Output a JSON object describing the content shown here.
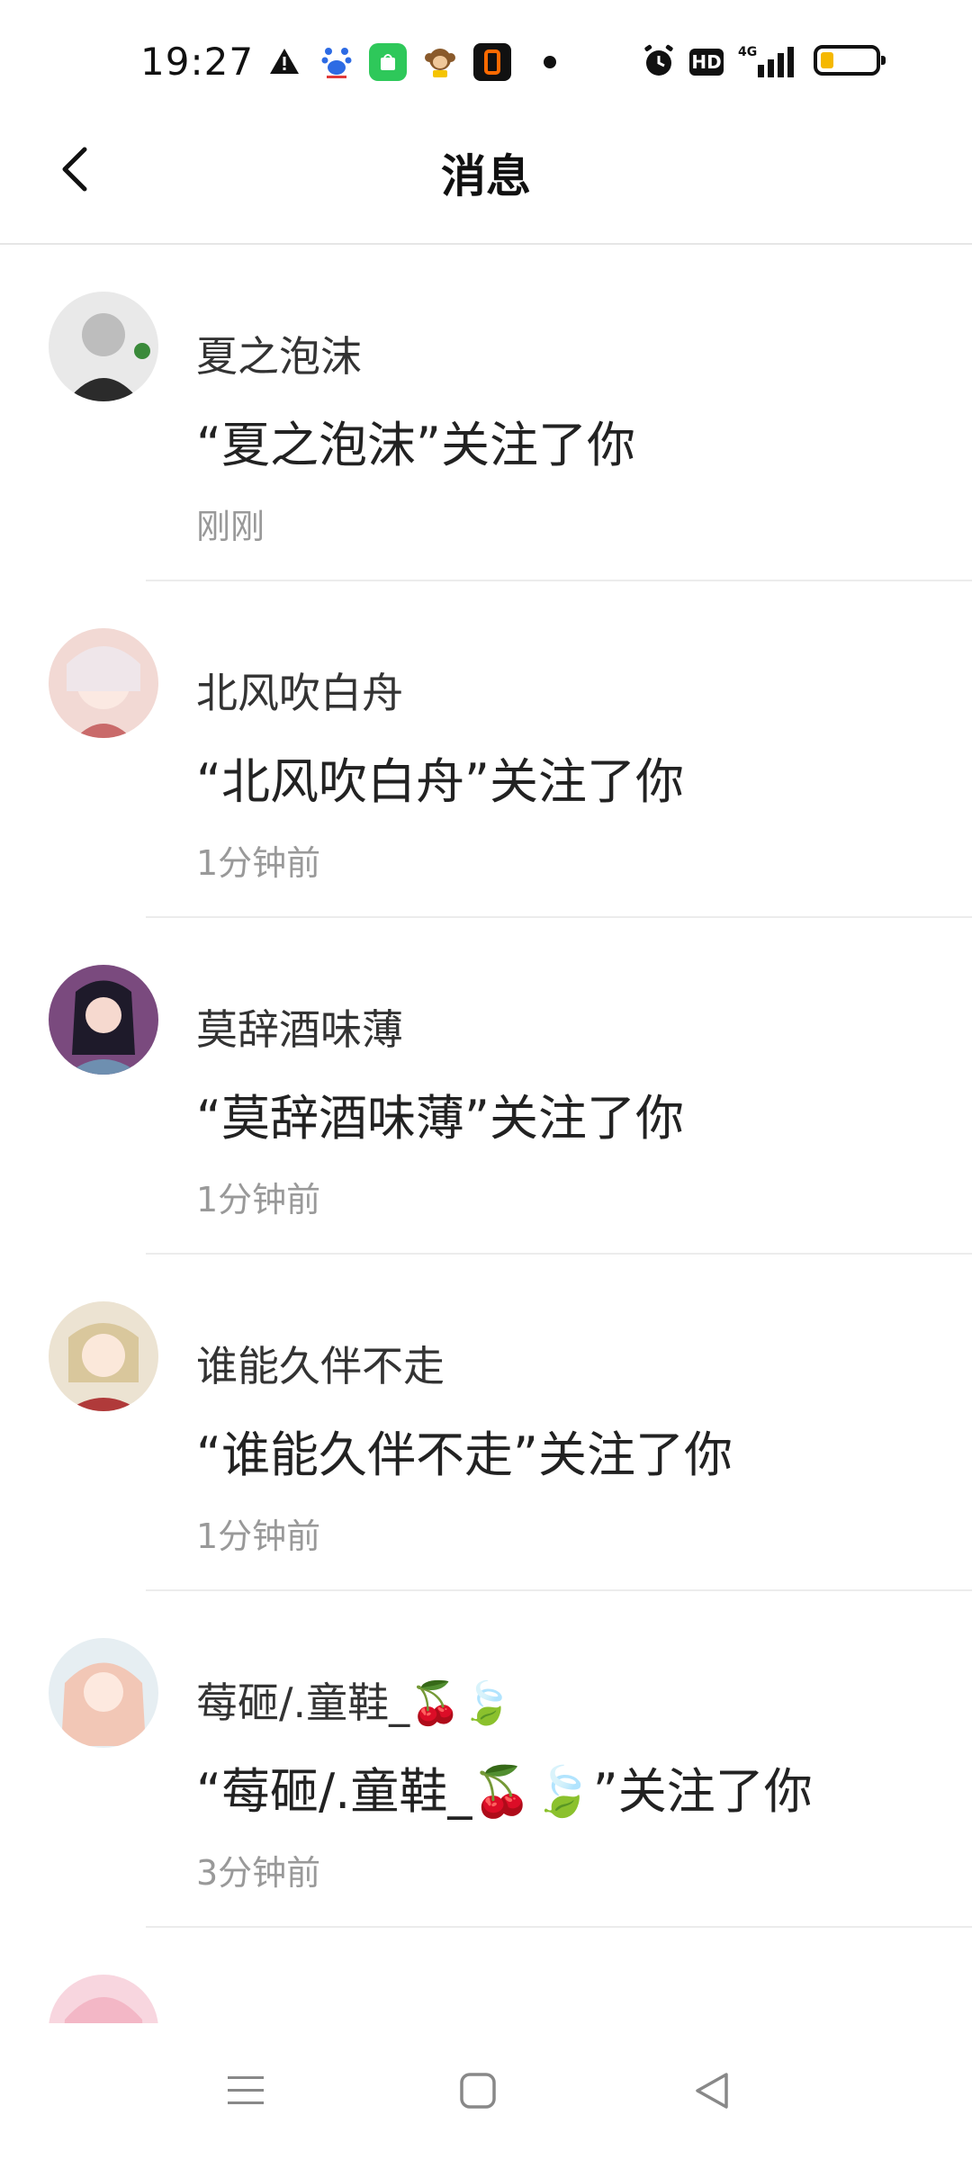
{
  "status_bar": {
    "time": "19:27",
    "icons": [
      "warning-icon",
      "baidu-icon",
      "app-green-icon",
      "monkey-icon",
      "orange-app-icon",
      "dot-icon",
      "alarm-icon",
      "hd-icon",
      "4g-signal-icon",
      "battery-icon"
    ],
    "hd_label": "HD",
    "network_label": "4G"
  },
  "header": {
    "title": "消息",
    "back_icon": "chevron-left-icon"
  },
  "notifications": [
    {
      "name": "夏之泡沫",
      "message": "“夏之泡沫”关注了你",
      "time": "刚刚",
      "avatar_color": "#6b6b6b"
    },
    {
      "name": "北风吹白舟",
      "message": "“北风吹白舟”关注了你",
      "time": "1分钟前",
      "avatar_color": "#e8b9b9"
    },
    {
      "name": "莫辞酒味薄",
      "message": "“莫辞酒味薄”关注了你",
      "time": "1分钟前",
      "avatar_color": "#4a3a5e"
    },
    {
      "name": "谁能久伴不走",
      "message": "“谁能久伴不走”关注了你",
      "time": "1分钟前",
      "avatar_color": "#d8c8a8"
    },
    {
      "name": "莓砸/.童鞋_🍒🍃",
      "message": "“莓砸/.童鞋_🍒🍃”关注了你",
      "time": "3分钟前",
      "avatar_color": "#e9c7b8"
    },
    {
      "name": "",
      "message": "",
      "time": "",
      "avatar_color": "#f3b7c6"
    }
  ],
  "nav_bar": {
    "menu_icon": "menu-icon",
    "home_icon": "home-square-icon",
    "back_icon": "back-triangle-icon"
  }
}
